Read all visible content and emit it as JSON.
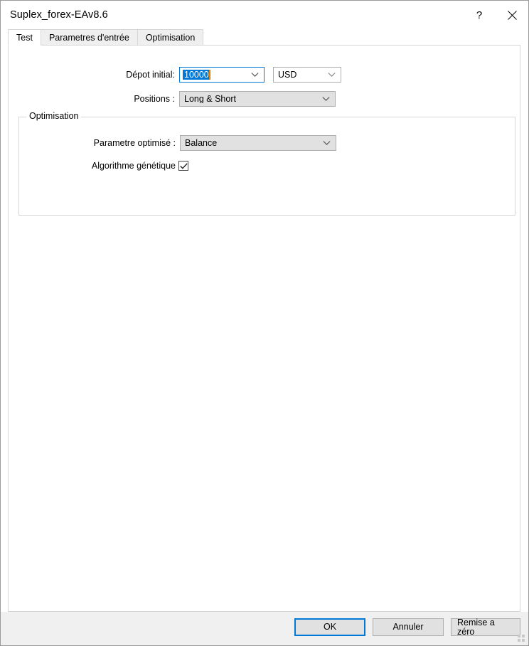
{
  "window": {
    "title": "Suplex_forex-EAv8.6",
    "help_icon": "question-mark-icon",
    "close_icon": "close-icon"
  },
  "tabs": [
    {
      "label": "Test",
      "active": true
    },
    {
      "label": "Parametres d'entrée",
      "active": false
    },
    {
      "label": "Optimisation",
      "active": false
    }
  ],
  "form": {
    "deposit": {
      "label": "Dépot initial:",
      "value": "10000",
      "selected": true,
      "currency_value": "USD"
    },
    "positions": {
      "label": "Positions :",
      "value": "Long & Short"
    }
  },
  "optimisation_group": {
    "title": "Optimisation",
    "parameter": {
      "label": "Parametre optimisé :",
      "value": "Balance"
    },
    "genetic": {
      "label": "Algorithme génétique",
      "checked": true
    }
  },
  "footer": {
    "ok_label": "OK",
    "cancel_label": "Annuler",
    "reset_label": "Remise a zéro",
    "grip_icon": "resize-grip-icon"
  },
  "colors": {
    "accent": "#0078d7",
    "selection_bg": "#0078d7",
    "selection_fg": "#ffffff",
    "caret": "#d97d00",
    "control_face": "#e1e1e1",
    "footer_bg": "#f0f0f0",
    "border": "#d6d6d6"
  }
}
